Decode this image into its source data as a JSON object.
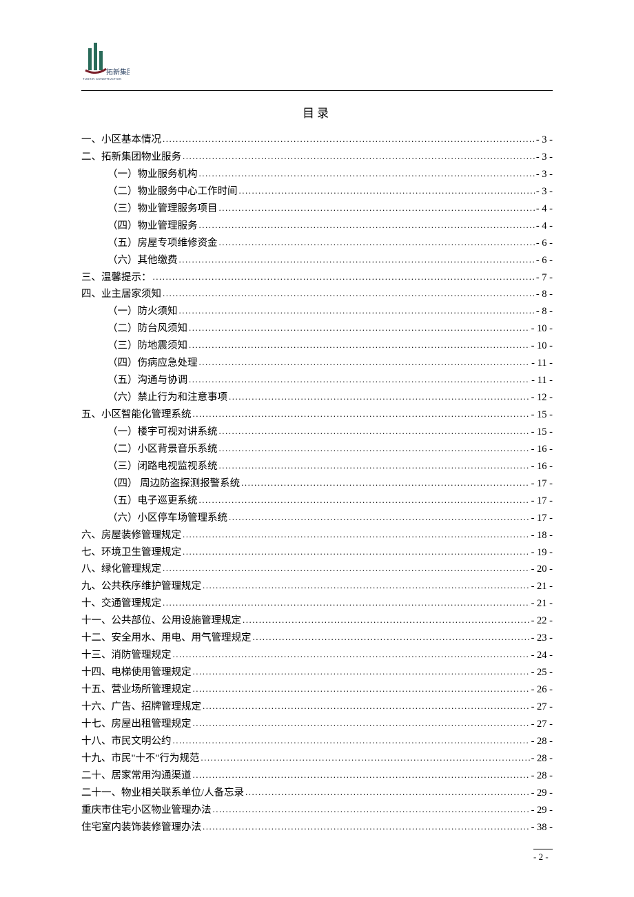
{
  "title": "目录",
  "logo_text_top": "拓新集团",
  "logo_text_sub": "TUOXIN CONSTRUCTION",
  "page_number": "- 2 -",
  "toc": [
    {
      "indent": 1,
      "label": "一、小区基本情况",
      "page": "- 3 -"
    },
    {
      "indent": 1,
      "label": "二、拓新集团物业服务",
      "page": "- 3 -"
    },
    {
      "indent": 2,
      "label": "（一）物业服务机构",
      "page": "- 3 -"
    },
    {
      "indent": 2,
      "label": "（二）物业服务中心工作时间",
      "page": "- 3 -"
    },
    {
      "indent": 2,
      "label": "（三）物业管理服务项目",
      "page": "- 4 -"
    },
    {
      "indent": 2,
      "label": "（四）物业管理服务",
      "page": "- 4 -"
    },
    {
      "indent": 2,
      "label": "（五）房屋专项维修资金",
      "page": "- 6 -"
    },
    {
      "indent": 2,
      "label": "（六）其他缴费",
      "page": "- 6 -"
    },
    {
      "indent": 1,
      "label": "三、温馨提示：",
      "page": "- 7 -"
    },
    {
      "indent": 1,
      "label": "四、业主居家须知",
      "page": "- 8 -"
    },
    {
      "indent": 2,
      "label": "（一）防火须知",
      "page": "- 8 -"
    },
    {
      "indent": 2,
      "label": "（二）防台风须知",
      "page": "- 10 -"
    },
    {
      "indent": 2,
      "label": "（三）防地震须知",
      "page": "- 10 -"
    },
    {
      "indent": 2,
      "label": "（四）伤病应急处理",
      "page": "- 11 -"
    },
    {
      "indent": 2,
      "label": "（五）沟通与协调",
      "page": "- 11 -"
    },
    {
      "indent": 2,
      "label": "（六）禁止行为和注意事项",
      "page": "- 12 -"
    },
    {
      "indent": 1,
      "label": "五、小区智能化管理系统",
      "page": "- 15 -"
    },
    {
      "indent": 2,
      "label": "（一）楼宇可视对讲系统",
      "page": "- 15 -"
    },
    {
      "indent": 2,
      "label": "（二）小区背景音乐系统",
      "page": "- 16 -"
    },
    {
      "indent": 2,
      "label": "（三）闭路电视监视系统",
      "page": "- 16 -"
    },
    {
      "indent": 2,
      "label": "（四） 周边防盗探测报警系统",
      "page": "- 17 -"
    },
    {
      "indent": 2,
      "label": "（五）电子巡更系统",
      "page": "- 17 -"
    },
    {
      "indent": 2,
      "label": "（六）小区停车场管理系统",
      "page": "- 17 -"
    },
    {
      "indent": 1,
      "label": "六、房屋装修管理规定",
      "page": "- 18 -"
    },
    {
      "indent": 1,
      "label": "七、环境卫生管理规定",
      "page": "- 19 -"
    },
    {
      "indent": 1,
      "label": "八、绿化管理规定",
      "page": "- 20 -"
    },
    {
      "indent": 1,
      "label": "九、公共秩序维护管理规定",
      "page": "- 21 -"
    },
    {
      "indent": 1,
      "label": "十、交通管理规定",
      "page": "- 21 -"
    },
    {
      "indent": 1,
      "label": "十一、公共部位、公用设施管理规定",
      "page": "- 22 -"
    },
    {
      "indent": 1,
      "label": "十二、安全用水、用电、用气管理规定",
      "page": "- 23 -"
    },
    {
      "indent": 1,
      "label": "十三、消防管理规定",
      "page": "- 24 -"
    },
    {
      "indent": 1,
      "label": "十四、电梯使用管理规定",
      "page": "- 25 -"
    },
    {
      "indent": 1,
      "label": "十五、营业场所管理规定",
      "page": "- 26 -"
    },
    {
      "indent": 1,
      "label": "十六、广告、招牌管理规定",
      "page": "- 27 -"
    },
    {
      "indent": 1,
      "label": "十七、房屋出租管理规定",
      "page": "- 27 -"
    },
    {
      "indent": 1,
      "label": "十八、市民文明公约",
      "page": "- 28 -"
    },
    {
      "indent": 1,
      "label": "十九、市民\"十不\"行为规范",
      "page": "- 28 -"
    },
    {
      "indent": 1,
      "label": "二十、居家常用沟通渠道",
      "page": "- 28 -"
    },
    {
      "indent": 1,
      "label": "二十一、物业相关联系单位/人备忘录",
      "page": "- 29 -"
    },
    {
      "indent": 1,
      "label": "重庆市住宅小区物业管理办法",
      "page": "- 29 -"
    },
    {
      "indent": 1,
      "label": "住宅室内装饰装修管理办法",
      "page": "- 38 -"
    }
  ]
}
